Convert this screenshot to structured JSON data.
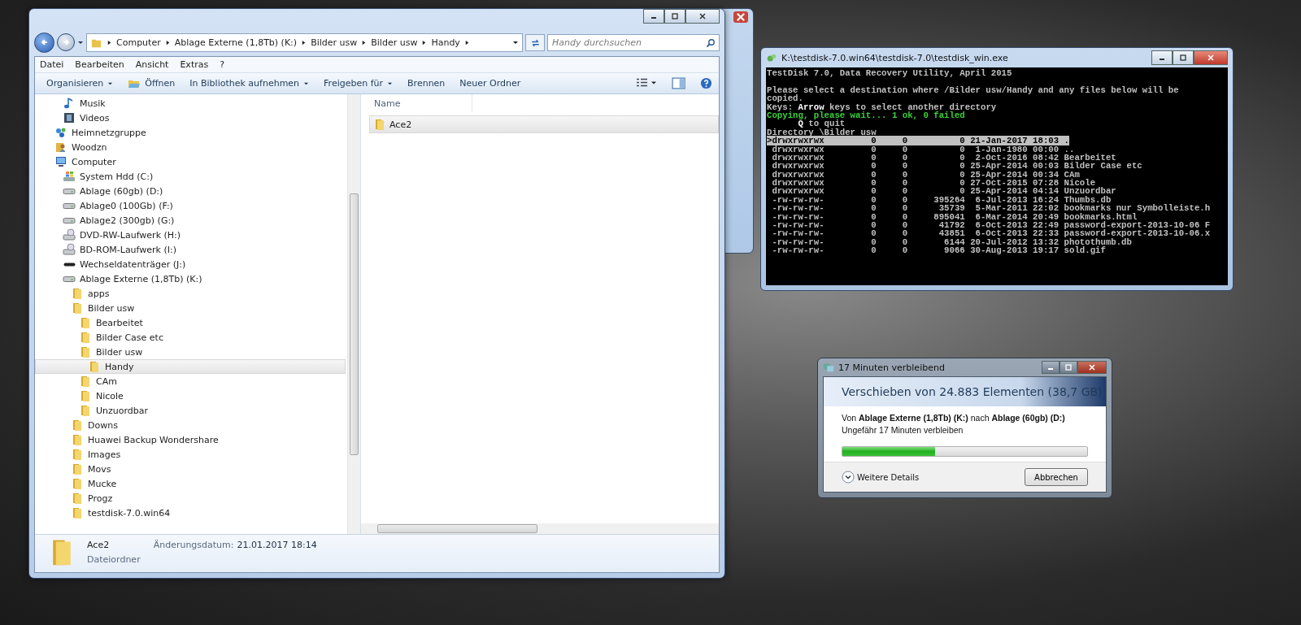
{
  "explorer": {
    "address": [
      "Computer",
      "Ablage Externe (1,8Tb) (K:)",
      "Bilder usw",
      "Bilder usw",
      "Handy"
    ],
    "search": {
      "placeholder": "Handy durchsuchen"
    },
    "menu": [
      "Datei",
      "Bearbeiten",
      "Ansicht",
      "Extras",
      "?"
    ],
    "toolbar": [
      {
        "label": "Organisieren",
        "kind": "menu"
      },
      {
        "label": "Öffnen",
        "kind": "open"
      },
      {
        "label": "In Bibliothek aufnehmen",
        "kind": "menu"
      },
      {
        "label": "Freigeben für",
        "kind": "menu"
      },
      {
        "label": "Brennen",
        "kind": "plain"
      },
      {
        "label": "Neuer Ordner",
        "kind": "plain"
      }
    ],
    "tree": {
      "scrolled_children": [
        {
          "label": "Musik",
          "kind": "music",
          "selected": false
        },
        {
          "label": "Videos",
          "kind": "video",
          "selected": false
        }
      ],
      "items": [
        {
          "label": "Heimnetzgruppe",
          "kind": "network",
          "selected": false
        },
        {
          "label": "Woodzn",
          "kind": "user",
          "selected": false
        },
        {
          "label": "Computer",
          "kind": "computer",
          "selected": false,
          "children": [
            {
              "label": "System Hdd (C:)",
              "kind": "windows-drive",
              "selected": false
            },
            {
              "label": "Ablage (60gb) (D:)",
              "kind": "drive",
              "selected": false
            },
            {
              "label": "Ablage0 (100Gb) (F:)",
              "kind": "drive",
              "selected": false
            },
            {
              "label": "Ablage2 (300gb) (G:)",
              "kind": "drive",
              "selected": false
            },
            {
              "label": "DVD-RW-Laufwerk (H:)",
              "kind": "optical",
              "selected": false
            },
            {
              "label": "BD-ROM-Laufwerk (I:)",
              "kind": "optical",
              "selected": false
            },
            {
              "label": "Wechseldatenträger (J:)",
              "kind": "removable",
              "selected": false
            },
            {
              "label": "Ablage Externe (1,8Tb) (K:)",
              "kind": "drive",
              "selected": false,
              "children": [
                {
                  "label": "apps",
                  "kind": "folder",
                  "selected": false
                },
                {
                  "label": "Bilder usw",
                  "kind": "folder",
                  "selected": false,
                  "children": [
                    {
                      "label": "Bearbeitet",
                      "kind": "folder",
                      "selected": false
                    },
                    {
                      "label": "Bilder Case etc",
                      "kind": "folder",
                      "selected": false
                    },
                    {
                      "label": "Bilder usw",
                      "kind": "folder",
                      "selected": false,
                      "children": [
                        {
                          "label": "Handy",
                          "kind": "folder",
                          "selected": true
                        }
                      ]
                    },
                    {
                      "label": "CAm",
                      "kind": "folder",
                      "selected": false
                    },
                    {
                      "label": "Nicole",
                      "kind": "folder",
                      "selected": false
                    },
                    {
                      "label": "Unzuordbar",
                      "kind": "folder",
                      "selected": false
                    }
                  ]
                },
                {
                  "label": "Downs",
                  "kind": "folder",
                  "selected": false
                },
                {
                  "label": "Huawei Backup Wondershare",
                  "kind": "folder",
                  "selected": false
                },
                {
                  "label": "Images",
                  "kind": "folder",
                  "selected": false
                },
                {
                  "label": "Movs",
                  "kind": "folder",
                  "selected": false
                },
                {
                  "label": "Mucke",
                  "kind": "folder",
                  "selected": false
                },
                {
                  "label": "Progz",
                  "kind": "folder",
                  "selected": false
                },
                {
                  "label": "testdisk-7.0.win64",
                  "kind": "folder",
                  "selected": false
                }
              ]
            }
          ]
        }
      ]
    },
    "column": "Name",
    "files": [
      {
        "name": "Ace2",
        "selected": true
      }
    ],
    "details": {
      "name": "Ace2",
      "date_label": "Änderungsdatum:",
      "date": "21.01.2017 18:14",
      "type": "Dateiordner"
    }
  },
  "console": {
    "title": "K:\\testdisk-7.0.win64\\testdisk-7.0\\testdisk_win.exe",
    "lines": [
      {
        "text": "TestDisk 7.0, Data Recovery Utility, April 2015",
        "kind": "normal"
      },
      {
        "kind": "blank"
      },
      {
        "text": "Please select a destination where /Bilder usw/Handy and any files below will be",
        "kind": "normal"
      },
      {
        "text": "copied.",
        "kind": "normal"
      },
      {
        "text": "Keys: **Arrow** keys to select another directory",
        "kind": "normal"
      },
      {
        "text": "Copying, please wait... 1 ok, 0 failed",
        "kind": "green"
      },
      {
        "text": "      **Q** to quit",
        "kind": "normal"
      },
      {
        "text": "Directory \\Bilder usw",
        "kind": "normal"
      }
    ],
    "rows": [
      {
        "text": ">drwxrwxrwx         0     0          0 21-Jan-2017 18:03 .",
        "selected": true
      },
      {
        "text": " drwxrwxrwx         0     0          0  1-Jan-1980 00:00 ..",
        "selected": false
      },
      {
        "text": " drwxrwxrwx         0     0          0  2-Oct-2016 08:42 Bearbeitet",
        "selected": false
      },
      {
        "text": " drwxrwxrwx         0     0          0 25-Apr-2014 00:03 Bilder Case etc",
        "selected": false
      },
      {
        "text": " drwxrwxrwx         0     0          0 25-Apr-2014 00:34 CAm",
        "selected": false
      },
      {
        "text": " drwxrwxrwx         0     0          0 27-Oct-2015 07:28 Nicole",
        "selected": false
      },
      {
        "text": " drwxrwxrwx         0     0          0 25-Apr-2014 04:14 Unzuordbar",
        "selected": false
      },
      {
        "text": " -rw-rw-rw-         0     0     395264  6-Jul-2013 16:24 Thumbs.db",
        "selected": false
      },
      {
        "text": " -rw-rw-rw-         0     0      35739  5-Mar-2011 22:02 bookmarks nur Symbolleiste.h",
        "selected": false
      },
      {
        "text": " -rw-rw-rw-         0     0     895041  6-Mar-2014 20:49 bookmarks.html",
        "selected": false
      },
      {
        "text": " -rw-rw-rw-         0     0      41792  6-Oct-2013 22:49 password-export-2013-10-06 F",
        "selected": false
      },
      {
        "text": " -rw-rw-rw-         0     0      43851  6-Oct-2013 22:33 password-export-2013-10-06.x",
        "selected": false
      },
      {
        "text": " -rw-rw-rw-         0     0       6144 20-Jul-2012 13:32 photothumb.db",
        "selected": false
      },
      {
        "text": " -rw-rw-rw-         0     0       9066 30-Aug-2013 19:17 sold.gif",
        "selected": false
      }
    ]
  },
  "copy_dialog": {
    "title": "17 Minuten verbleibend",
    "heading": "Verschieben von 24.883 Elementen (38,7 GB)",
    "route": "Von **Ablage Externe (1,8Tb) (K:)** nach **Ablage (60gb) (D:)**",
    "remaining": "Ungefähr 17 Minuten verbleiben",
    "level": 0.38,
    "details": "Weitere Details",
    "cancel": "Abbrechen"
  }
}
